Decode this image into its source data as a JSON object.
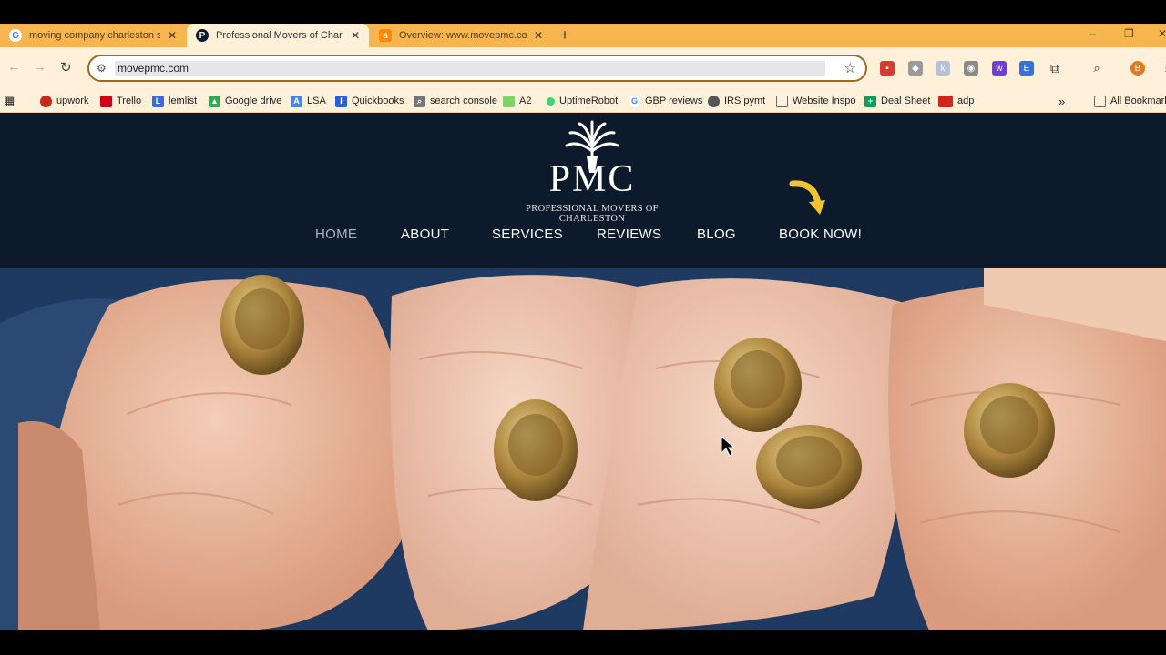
{
  "browser": {
    "tabs": [
      {
        "title": "moving company charleston sc",
        "favicon": "google-icon"
      },
      {
        "title": "Professional Movers of Charleston",
        "favicon": "pmc-icon"
      },
      {
        "title": "Overview: www.movepmc.com",
        "favicon": "ahrefs-icon"
      }
    ],
    "new_tab_label": "+",
    "window_controls": [
      "–",
      "❐",
      "✕"
    ],
    "address": "movepmc.com",
    "bookmarks": [
      {
        "label": "upwork",
        "icon": "upwork-icon",
        "color": "#c42b1c"
      },
      {
        "label": "Trello",
        "icon": "trello-icon",
        "color": "#d0021b"
      },
      {
        "label": "lemlist",
        "icon": "lemlist-icon",
        "color": "#3f6ad8"
      },
      {
        "label": "Google drive",
        "icon": "drive-icon",
        "color": "#34a853"
      },
      {
        "label": "LSA",
        "icon": "lsa-icon",
        "color": "#4285f4"
      },
      {
        "label": "Quickbooks",
        "icon": "quickbooks-icon",
        "color": "#2b5fd9"
      },
      {
        "label": "search console",
        "icon": "search-console-icon",
        "color": "#777777"
      },
      {
        "label": "A2",
        "icon": "a2-icon",
        "color": "#7bd36a"
      },
      {
        "label": "UptimeRobot",
        "icon": "uptimerobot-icon",
        "color": "#3bd671"
      },
      {
        "label": "GBP reviews",
        "icon": "google-icon",
        "color": "#4285f4"
      },
      {
        "label": "IRS pymt",
        "icon": "irs-icon",
        "color": "#555555"
      },
      {
        "label": "Website Inspo",
        "icon": "folder-icon",
        "color": "#666666"
      },
      {
        "label": "Deal Sheet",
        "icon": "sheets-icon",
        "color": "#0f9d58"
      },
      {
        "label": "adp",
        "icon": "adp-icon",
        "color": "#d0271d"
      }
    ],
    "overflow_label": "»",
    "all_bookmarks": "All Bookmarks"
  },
  "site": {
    "logo_mark": "PMC",
    "logo_tagline": "PROFESSIONAL MOVERS OF CHARLESTON",
    "menu": [
      "HOME",
      "ABOUT",
      "SERVICES",
      "REVIEWS",
      "BLOG",
      "BOOK NOW!"
    ],
    "active_menu": "HOME",
    "accent_color": "#f2c230",
    "header_color": "#0c1a2c"
  }
}
